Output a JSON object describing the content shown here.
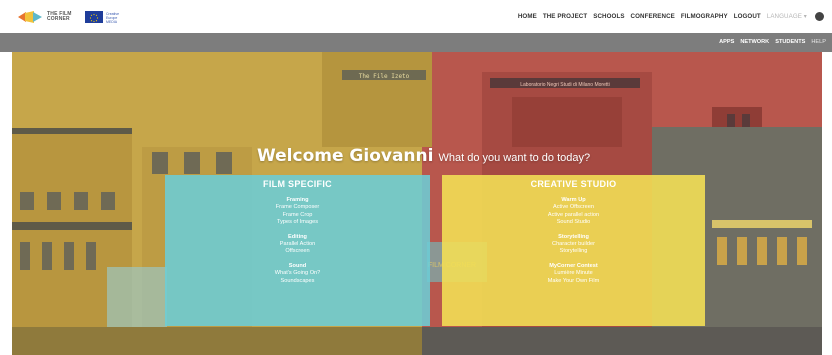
{
  "brand": {
    "logo_text_1": "THE FILM",
    "logo_text_2": "CORNER",
    "eu_text": "Creative Europe MEDIA"
  },
  "colors": {
    "subbar": "#7d7d7d",
    "left_bg": "#c6a64a",
    "right_bg": "#b8574d",
    "left_panel": "#6ccdd6",
    "right_panel": "#f2de55"
  },
  "main_nav": [
    "HOME",
    "THE PROJECT",
    "SCHOOLS",
    "CONFERENCE",
    "FILMOGRAPHY",
    "LOGOUT"
  ],
  "language_label": "LANGUAGE ▾",
  "sub_nav": [
    "APPS",
    "NETWORK",
    "STUDENTS",
    "HELP"
  ],
  "welcome": {
    "heading": "Welcome Giovanni",
    "question": "What do you want to do today?"
  },
  "building_signs": {
    "left": "The File Izeto",
    "right": "Laboratorio Negri Studi di Milano Moretti",
    "film_corner": "FILM CORNER"
  },
  "panels": [
    {
      "title": "FILM SPECIFIC",
      "sections": [
        {
          "title": "Framing",
          "links": [
            "Frame Composer",
            "Frame Crop",
            "Types of Images"
          ]
        },
        {
          "title": "Editing",
          "links": [
            "Parallel Action",
            "Offscreen"
          ]
        },
        {
          "title": "Sound",
          "links": [
            "What's Going On?",
            "Soundscapes"
          ]
        }
      ]
    },
    {
      "title": "CREATIVE STUDIO",
      "sections": [
        {
          "title": "Warm Up",
          "links": [
            "Active Offscreen",
            "Active parallel action",
            "Sound Studio"
          ]
        },
        {
          "title": "Storytelling",
          "links": [
            "Character builder",
            "Storytelling"
          ]
        },
        {
          "title": "MyCorner Contest",
          "links": [
            "Lumière Minute",
            "Make Your Own Film"
          ]
        }
      ]
    }
  ]
}
